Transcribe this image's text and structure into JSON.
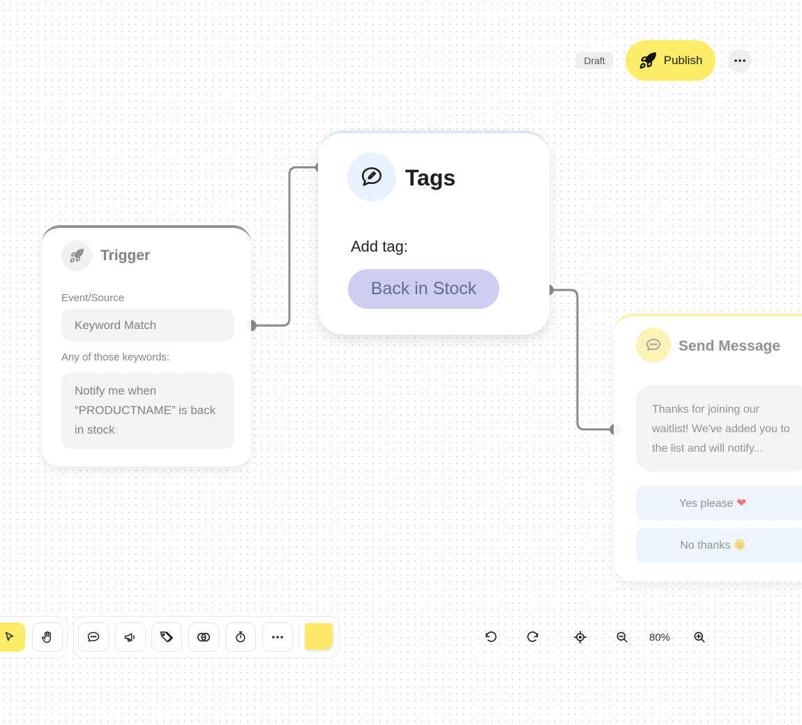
{
  "header": {
    "status_badge": "Draft",
    "publish_label": "Publish",
    "more_icon": "more-horizontal-icon"
  },
  "nodes": {
    "trigger": {
      "title": "Trigger",
      "icon": "rocket-icon",
      "event_label": "Event/Source",
      "event_value": "Keyword Match",
      "keywords_label": "Any of those keywords:",
      "keywords_value": "Notify me when “PRODUCTNAME” is back in stock"
    },
    "tags": {
      "title": "Tags",
      "icon": "chat-bubble-pen-icon",
      "add_tag_label": "Add tag:",
      "tag": "Back in Stock"
    },
    "send_message": {
      "title": "Send Message",
      "icon": "chat-bubble-icon",
      "message": "Thanks for joining our waitlist! We've added you to the list and will notify...",
      "replies": [
        {
          "label": "Yes please",
          "emoji": "heart-emoji"
        },
        {
          "label": "No thanks",
          "emoji": "sad-face-emoji"
        }
      ]
    }
  },
  "toolbar": {
    "tools": [
      "pointer-icon",
      "hand-icon"
    ],
    "blocks": [
      "chat-icon",
      "megaphone-icon",
      "tag-icon",
      "coins-icon",
      "timer-icon",
      "more-icon"
    ],
    "sticky_note": "sticky-note-icon"
  },
  "zoom": {
    "level": "80%",
    "controls": [
      "undo-icon",
      "redo-icon",
      "recenter-icon",
      "zoom-out-icon",
      "zoom-in-icon"
    ]
  },
  "colors": {
    "accent_yellow": "#fcec68",
    "tag_chip": "#cfcdf0",
    "connector": "#8a8a8a"
  }
}
